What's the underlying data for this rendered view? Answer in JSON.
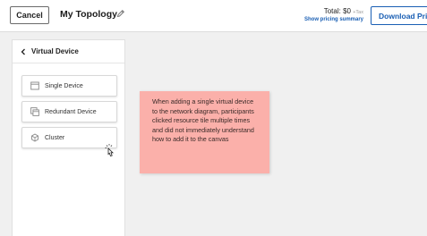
{
  "header": {
    "cancel_label": "Cancel",
    "title": "My Topology",
    "total_label": "Total: $0",
    "tax_label": "+Tax",
    "pricing_link": "Show pricing summary",
    "download_label": "Download Pric"
  },
  "panel": {
    "title": "Virtual Device",
    "tiles": [
      {
        "label": "Single Device",
        "icon": "single-device-icon"
      },
      {
        "label": "Redundant Device",
        "icon": "redundant-device-icon"
      },
      {
        "label": "Cluster",
        "icon": "cluster-icon"
      }
    ]
  },
  "note": {
    "text": "When adding a single virtual device to the network diagram, participants clicked resource tile multiple times and did not immediately understand how to add it to the canvas"
  },
  "colors": {
    "link": "#1a5fb4",
    "sticky_note": "#fbb0aa",
    "background": "#f0f0f0"
  }
}
